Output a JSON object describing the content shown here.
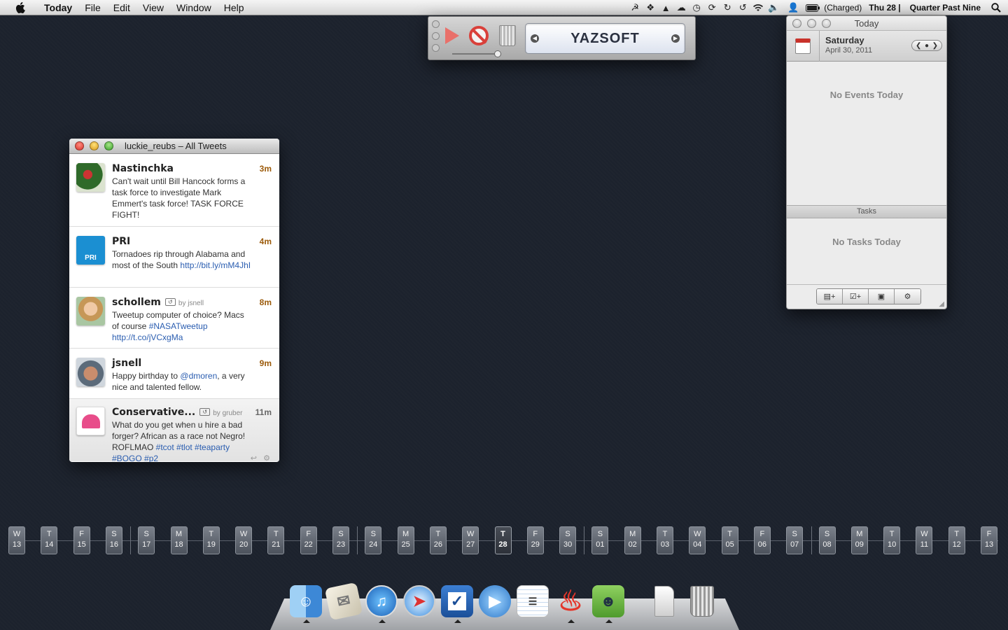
{
  "menubar": {
    "app": "Today",
    "menus": [
      "File",
      "Edit",
      "View",
      "Window",
      "Help"
    ],
    "battery": "(Charged)",
    "date": "Thu 28 |",
    "time": "Quarter Past Nine",
    "status_icons": [
      "evernote-icon",
      "dropbox-icon",
      "broom-icon",
      "cloud-icon",
      "clock-icon",
      "sync-icon",
      "refresh-icon",
      "time-machine-icon",
      "wifi-icon",
      "volume-icon",
      "user-icon",
      "battery-icon"
    ]
  },
  "twitter": {
    "title": "luckie_reubs – All Tweets",
    "tweets": [
      {
        "name": "Nastinchka",
        "time": "3m",
        "by": "",
        "text": "Can't wait until Bill Hancock forms a task force to investigate Mark Emmert's task force! TASK FORCE FIGHT!",
        "link": ""
      },
      {
        "name": "PRI",
        "time": "4m",
        "by": "",
        "text": "Tornadoes rip through Alabama and most of the South ",
        "link": "http://bit.ly/mM4JhI"
      },
      {
        "name": "schollem",
        "time": "8m",
        "by": "by jsnell",
        "text": "Tweetup computer of choice? Macs of course ",
        "link": "#NASATweetup http://t.co/jVCxgMa"
      },
      {
        "name": "jsnell",
        "time": "9m",
        "by": "",
        "text_a": "Happy birthday to ",
        "mention": "@dmoren",
        "text_b": ", a very nice and talented fellow."
      },
      {
        "name": "Conservative...",
        "time": "11m",
        "by": "by gruber",
        "text": "What do you get when u hire a bad forger? African as a race not Negro! ROFLMAO ",
        "link": "#tcot #tlot #teaparty #BOGO #p2"
      }
    ]
  },
  "player": {
    "brand": "YAZSOFT"
  },
  "today": {
    "title": "Today",
    "day": "Saturday",
    "date": "April 30, 2011",
    "no_events": "No Events Today",
    "tasks_header": "Tasks",
    "no_tasks": "No Tasks Today"
  },
  "timeline": [
    {
      "d": "W",
      "n": "13"
    },
    {
      "d": "T",
      "n": "14"
    },
    {
      "d": "F",
      "n": "15"
    },
    {
      "d": "S",
      "n": "16"
    },
    {
      "d": "S",
      "n": "17"
    },
    {
      "d": "M",
      "n": "18"
    },
    {
      "d": "T",
      "n": "19"
    },
    {
      "d": "W",
      "n": "20"
    },
    {
      "d": "T",
      "n": "21"
    },
    {
      "d": "F",
      "n": "22"
    },
    {
      "d": "S",
      "n": "23"
    },
    {
      "d": "S",
      "n": "24"
    },
    {
      "d": "M",
      "n": "25"
    },
    {
      "d": "T",
      "n": "26"
    },
    {
      "d": "W",
      "n": "27"
    },
    {
      "d": "T",
      "n": "28",
      "today": true
    },
    {
      "d": "F",
      "n": "29"
    },
    {
      "d": "S",
      "n": "30"
    },
    {
      "d": "S",
      "n": "01"
    },
    {
      "d": "M",
      "n": "02"
    },
    {
      "d": "T",
      "n": "03"
    },
    {
      "d": "W",
      "n": "04"
    },
    {
      "d": "T",
      "n": "05"
    },
    {
      "d": "F",
      "n": "06"
    },
    {
      "d": "S",
      "n": "07"
    },
    {
      "d": "S",
      "n": "08"
    },
    {
      "d": "M",
      "n": "09"
    },
    {
      "d": "T",
      "n": "10"
    },
    {
      "d": "W",
      "n": "11"
    },
    {
      "d": "T",
      "n": "12"
    },
    {
      "d": "F",
      "n": "13"
    }
  ],
  "dock": [
    "finder-icon",
    "mail-icon",
    "itunes-icon",
    "safari-icon",
    "tasks-icon",
    "ichat-icon",
    "notes-icon",
    "flame-icon",
    "evernote-icon",
    "documents-icon",
    "trash-icon"
  ],
  "colors": {
    "desktop": "#1c222d",
    "time_label": "#9b5a0a",
    "link": "#2a5db0"
  }
}
